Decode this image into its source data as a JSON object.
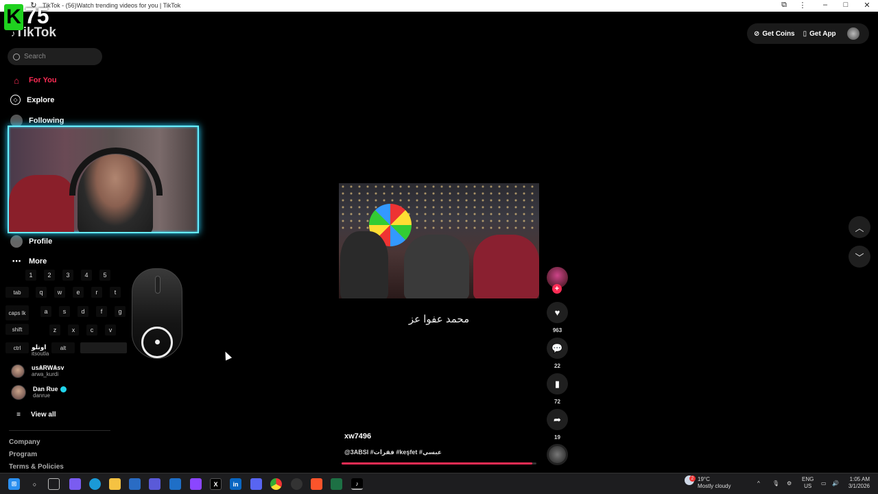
{
  "window": {
    "title": "TikTok - (56)Watch trending videos for you | TikTok",
    "controls": {
      "min": "–",
      "max": "□",
      "close": "✕"
    }
  },
  "overlay": {
    "badge_letter": "K",
    "badge_number": "75"
  },
  "app": {
    "logo": "TikTok",
    "search_placeholder": "Search",
    "nav": [
      {
        "label": "For You",
        "icon": "home-icon",
        "active": true
      },
      {
        "label": "Explore",
        "icon": "compass-icon"
      },
      {
        "label": "Following",
        "icon": "following-avatar"
      },
      {
        "label": "Profile",
        "icon": "profile-avatar"
      },
      {
        "label": "More",
        "icon": "more-icon"
      }
    ]
  },
  "keyboard": {
    "numbers": [
      "1",
      "2",
      "3",
      "4",
      "5"
    ],
    "row1": [
      "tab",
      "q",
      "w",
      "e",
      "r",
      "t"
    ],
    "row2": [
      "caps lk",
      "a",
      "s",
      "d",
      "f",
      "g"
    ],
    "row3": [
      "shift",
      "z",
      "x",
      "c",
      "v"
    ],
    "row4": [
      "ctrl",
      "alt"
    ]
  },
  "accounts": [
    {
      "name": "اوتلو",
      "user": "itsoutla"
    },
    {
      "name": "usѦRWѦsv",
      "user": "arwa_kurdi"
    },
    {
      "name": "Dan Rue",
      "user": "danrue",
      "verified": true
    }
  ],
  "view_all": "View all",
  "footer": [
    "Company",
    "Program",
    "Terms & Policies"
  ],
  "header_actions": {
    "coins": "Get Coins",
    "app": "Get App"
  },
  "video": {
    "caption": "محمد عفوا عز",
    "author": "xw7496",
    "tags": "@3ABSI #فقرات #keşfet #عبسي",
    "progress": 0.98,
    "likes": "963",
    "comments": "22",
    "saves": "72",
    "shares": "19"
  },
  "taskbar": {
    "weather_temp": "19°C",
    "weather_desc": "Mostly cloudy",
    "weather_badge": "2",
    "lang": "ENG",
    "region": "US",
    "time": "1:05 AM",
    "date": "3/1/2026"
  }
}
